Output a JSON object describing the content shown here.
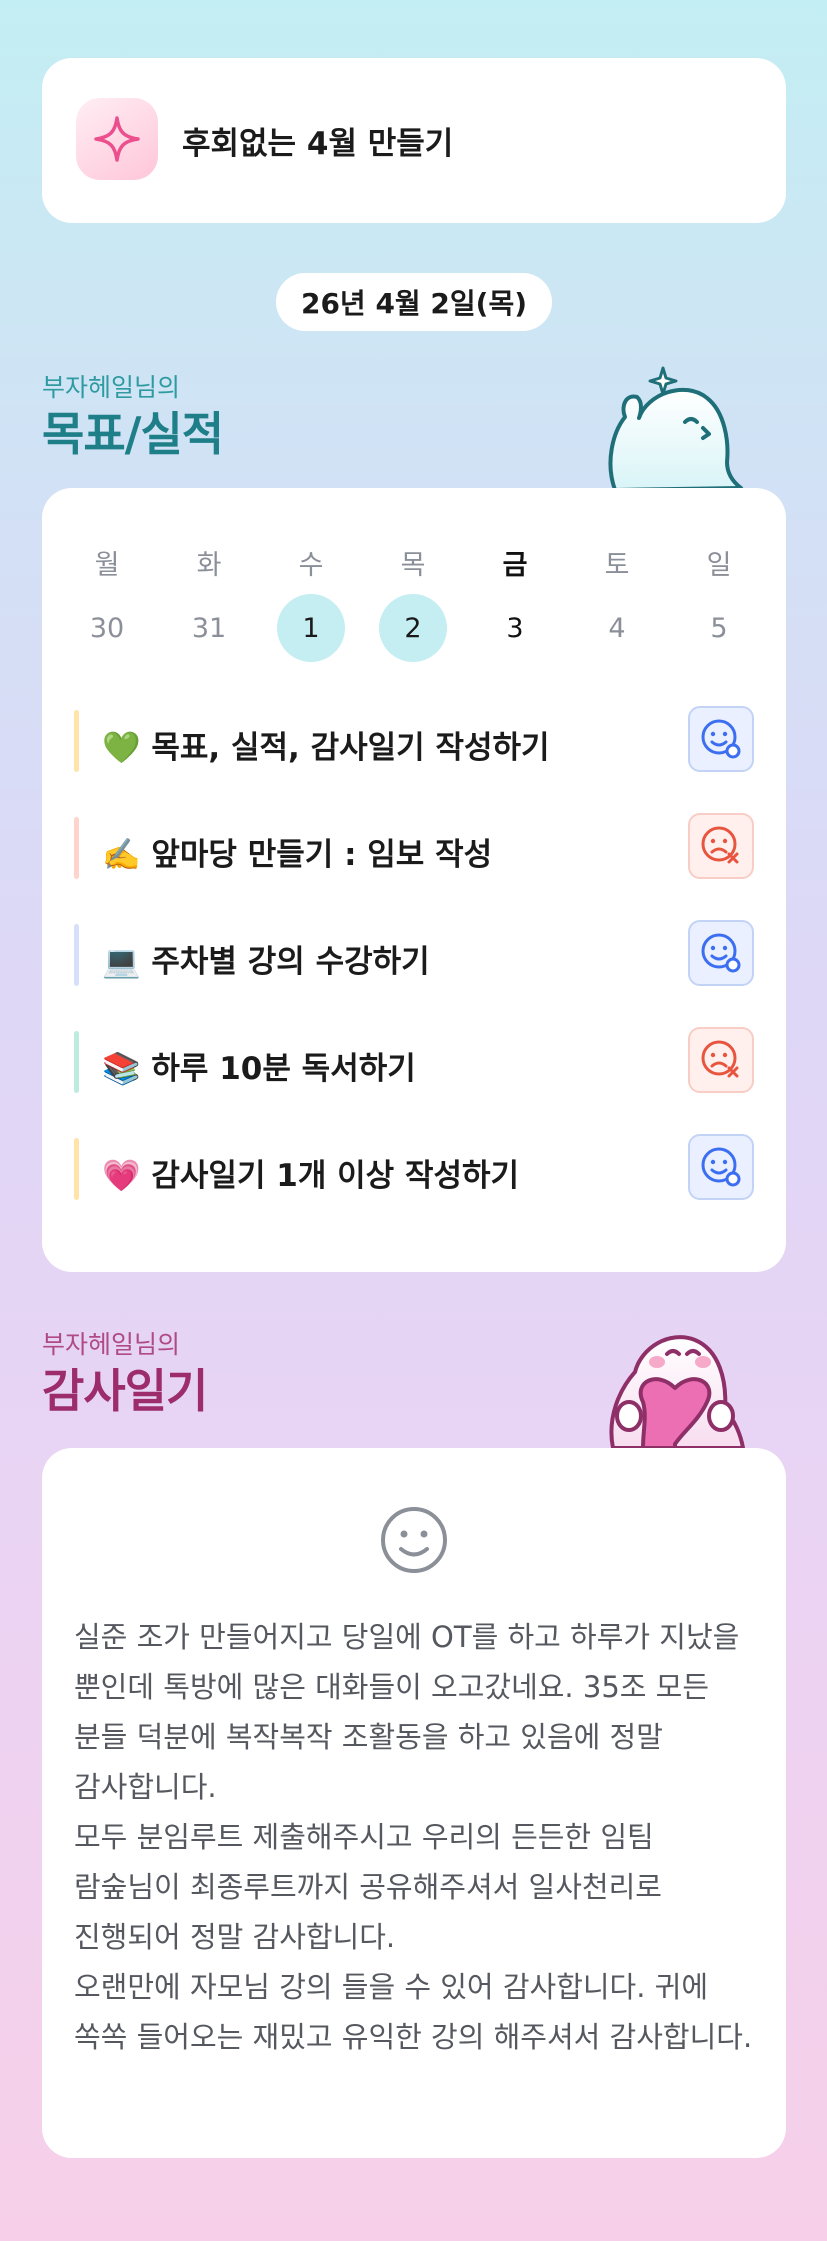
{
  "header": {
    "title": "후회없는 4월 만들기",
    "icon": "sparkle-icon"
  },
  "date_label": "26년 4월 2일(목)",
  "goals_section": {
    "subtitle": "부자헤일님의",
    "title": "목표/실적"
  },
  "calendar": {
    "days": [
      "월",
      "화",
      "수",
      "목",
      "금",
      "토",
      "일"
    ],
    "dates": [
      "30",
      "31",
      "1",
      "2",
      "3",
      "4",
      "5"
    ],
    "completed": [
      false,
      false,
      true,
      true,
      false,
      false,
      false
    ],
    "today_index": 4
  },
  "goals": [
    {
      "label": "💚 목표, 실적, 감사일기 작성하기",
      "status": "done",
      "bar_color": "#ffe3a8"
    },
    {
      "label": "✍️ 앞마당 만들기 : 임보 작성",
      "status": "fail",
      "bar_color": "#ffd4cc"
    },
    {
      "label": "💻 주차별 강의 수강하기",
      "status": "done",
      "bar_color": "#d7e0fb"
    },
    {
      "label": "📚 하루 10분 독서하기",
      "status": "fail",
      "bar_color": "#bdebdf"
    },
    {
      "label": "💗 감사일기 1개 이상 작성하기",
      "status": "done",
      "bar_color": "#ffe3a8"
    }
  ],
  "status_colors": {
    "done": "#3b6ef0",
    "fail": "#e8553f"
  },
  "gratitude_section": {
    "subtitle": "부자헤일님의",
    "title": "감사일기",
    "icon": "smile-icon",
    "text": "실준 조가 만들어지고 당일에 OT를 하고 하루가 지났을 뿐인데 톡방에 많은 대화들이 오고갔네요. 35조 모든 분들 덕분에 복작복작 조활동을 하고 있음에 정말 감사합니다.\n모두 분임루트 제출해주시고 우리의 든든한 임팀 람숲님이 최종루트까지 공유해주셔서 일사천리로 진행되어 정말 감사합니다.\n오랜만에 자모님 강의 들을 수 있어 감사합니다. 귀에 쏙쏙 들어오는 재밌고 유익한 강의 해주셔서 감사합니다."
  }
}
